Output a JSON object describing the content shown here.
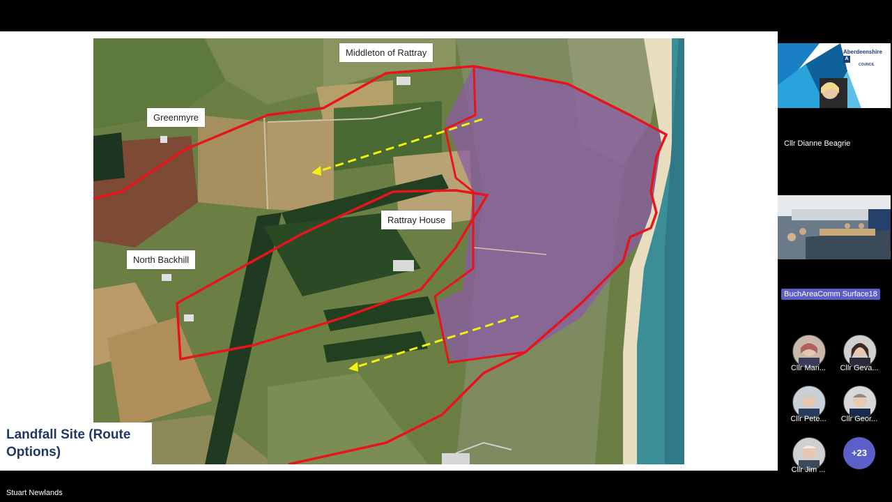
{
  "slide": {
    "title": "Landfall Site (Route Options)",
    "map_labels": {
      "middleton": "Middleton of Rattray",
      "greenmyre": "Greenmyre",
      "rattray_house": "Rattray House",
      "north_backhill": "North Backhill"
    }
  },
  "presenter": {
    "name": "Stuart Newlands"
  },
  "participants": {
    "featured": {
      "name": "Cllr Dianne Beagrie",
      "logo_text": "Aberdeenshire",
      "logo_sub": "COUNCIL"
    },
    "room_device": "BuchAreaComm Surface18",
    "avatars": [
      {
        "name": "Cllr Mari..."
      },
      {
        "name": "Cllr Geva..."
      },
      {
        "name": "Cllr Pete..."
      },
      {
        "name": "Cllr Geor..."
      },
      {
        "name": "Cllr Jim ..."
      }
    ],
    "more_count": "+23"
  },
  "colors": {
    "route_red": "#e8141b",
    "arrow_yellow": "#f5f20a",
    "zone_purple": "#8a5aa8",
    "accent": "#5b5fc7",
    "title_blue": "#1f3864"
  }
}
